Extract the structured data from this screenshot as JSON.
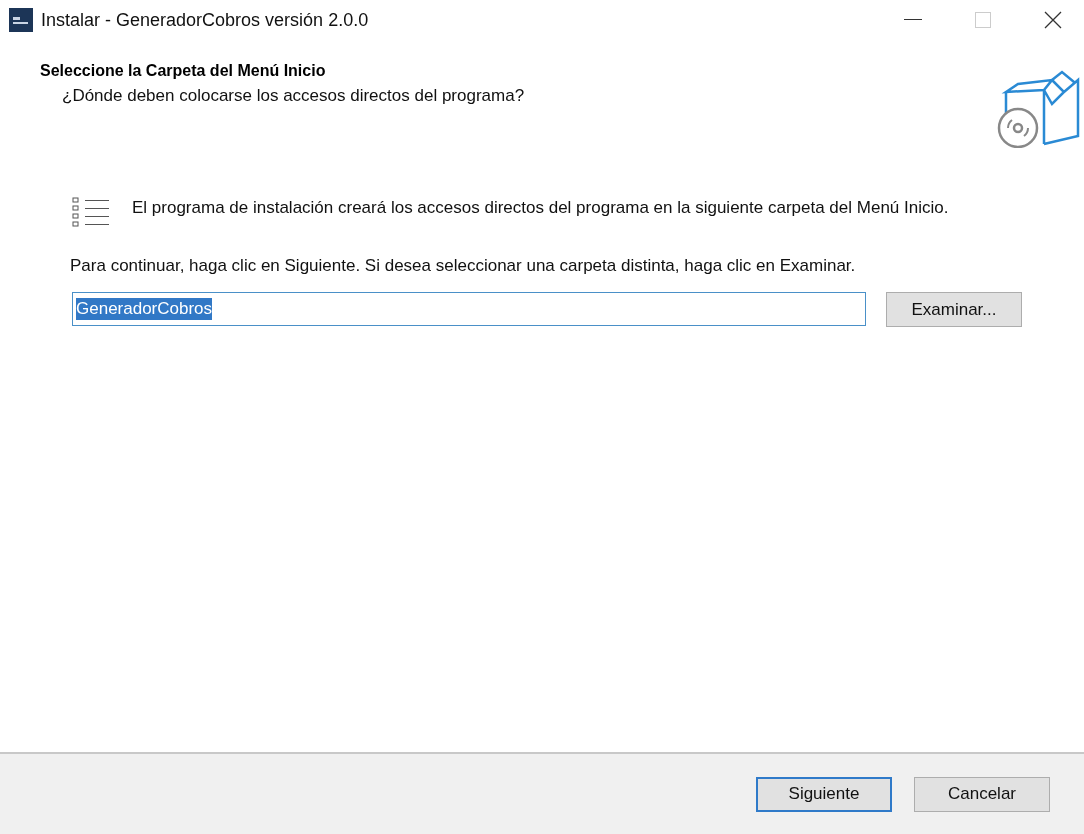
{
  "window": {
    "title": "Instalar - GeneradorCobros versión 2.0.0"
  },
  "header": {
    "title": "Seleccione la Carpeta del Menú Inicio",
    "subtitle": "¿Dónde deben colocarse los accesos directos del programa?"
  },
  "info": "El programa de instalación creará los accesos directos del programa en la siguiente carpeta del Menú Inicio.",
  "instruction": "Para continuar, haga clic en Siguiente. Si desea seleccionar una carpeta distinta, haga clic en Examinar.",
  "folder_field": {
    "value": "GeneradorCobros",
    "selected": true
  },
  "browse_button": "Examinar...",
  "buttons": [
    {
      "label": "Siguiente",
      "default": true
    },
    {
      "label": "Cancelar",
      "default": false
    }
  ]
}
